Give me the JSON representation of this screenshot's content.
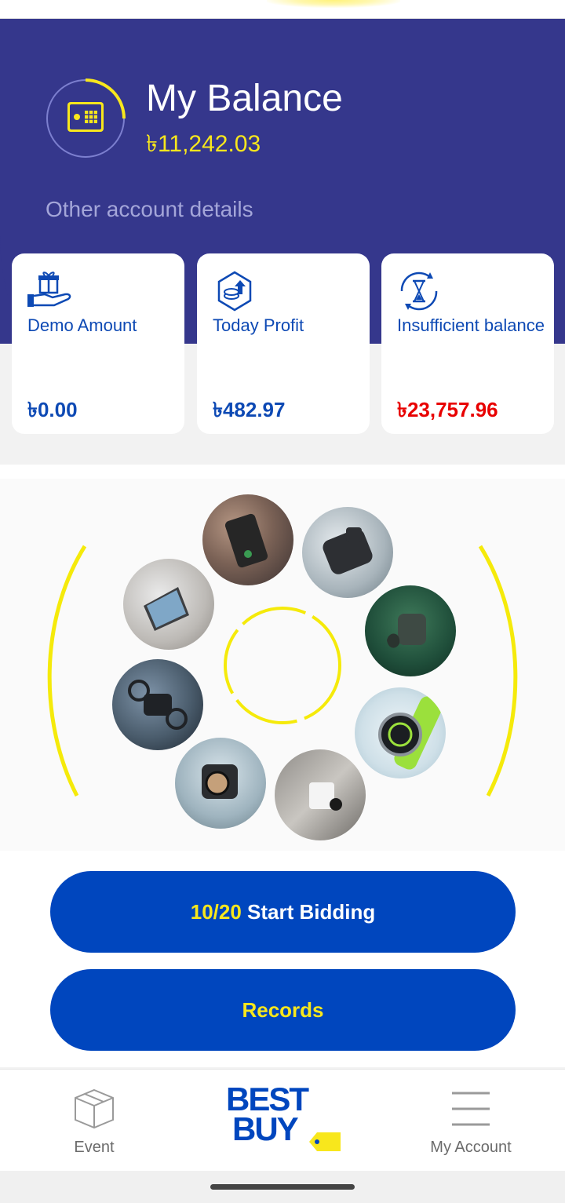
{
  "header": {
    "title": "My Balance",
    "balance": "৳11,242.03",
    "other_details": "Other account details"
  },
  "cards": [
    {
      "label": "Demo Amount",
      "value": "৳0.00",
      "icon": "gift-hand-icon",
      "value_color": "#0d49b4"
    },
    {
      "label": "Today Profit",
      "value": "৳482.97",
      "icon": "coins-up-icon",
      "value_color": "#0d49b4"
    },
    {
      "label": "Insufficient balance",
      "value": "৳23,757.96",
      "icon": "hourglass-icon",
      "value_color": "#e80000"
    }
  ],
  "gallery": {
    "products": [
      "phone-case-icon",
      "wireless-charger-icon",
      "earbuds-icon",
      "smartwatch-icon",
      "security-camera-icon",
      "action-camera-icon",
      "drone-icon",
      "laptop-icon"
    ]
  },
  "actions": {
    "bidding_count": "10/20",
    "bidding_label": "Start Bidding",
    "records_label": "Records"
  },
  "nav": {
    "event": "Event",
    "logo_line1": "BEST",
    "logo_line2": "BUY",
    "account": "My Account"
  },
  "colors": {
    "primary": "#35378c",
    "accent": "#f8e71c",
    "button": "#0046be",
    "danger": "#e80000"
  }
}
